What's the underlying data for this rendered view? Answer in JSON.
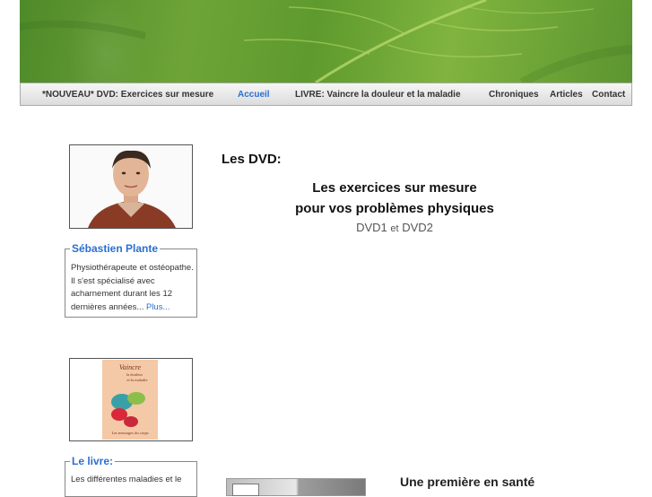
{
  "nav": {
    "items": [
      {
        "label": "*NOUVEAU* DVD: Exercices sur mesure"
      },
      {
        "label": "Accueil",
        "active": true
      },
      {
        "label": "LIVRE: Vaincre la douleur et la maladie"
      },
      {
        "label": "Chroniques"
      },
      {
        "label": "Articles"
      },
      {
        "label": "Contact"
      }
    ]
  },
  "profile": {
    "name": "Sébastien Plante",
    "bio": "Physiothérapeute et ostéopathe. Il s'est spécialisé avec acharnement durant les 12 dernières années...",
    "more": "Plus..."
  },
  "book": {
    "legend": "Le livre:",
    "cover_title_line1": "Vaincre",
    "cover_title_line2": "la douleur",
    "cover_title_line3": "et la maladie",
    "cover_footer": "Les messages du corps",
    "snippet": "Les différentes maladies et le"
  },
  "main": {
    "heading": "Les DVD:",
    "title_line1": "Les exercices sur mesure",
    "title_line2": "pour vos problèmes physiques",
    "sub_a": "DVD1",
    "sub_and": "et",
    "sub_b": "DVD2",
    "headline2": "Une première en santé"
  },
  "colors": {
    "link": "#2a6fd1",
    "banner_green": "#6ea437",
    "nav_bg": "#e6e6e6"
  }
}
